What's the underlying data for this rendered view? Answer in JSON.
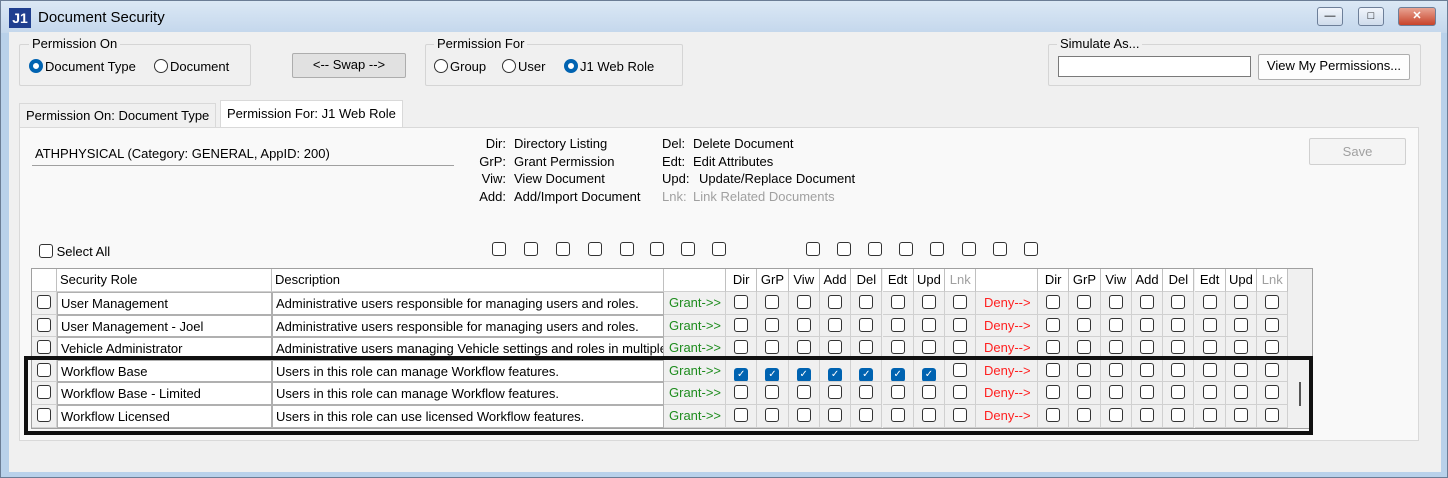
{
  "window": {
    "title": "Document Security",
    "logo": "J1",
    "minimize_icon": "minimize-icon",
    "maximize_icon": "maximize-icon",
    "close_icon": "close-icon"
  },
  "permission_on": {
    "label": "Permission On",
    "options": [
      {
        "label": "Document Type",
        "selected": true
      },
      {
        "label": "Document",
        "selected": false
      }
    ]
  },
  "swap_label": "<-- Swap -->",
  "permission_for": {
    "label": "Permission For",
    "options": [
      {
        "label": "Group",
        "selected": false
      },
      {
        "label": "User",
        "selected": false
      },
      {
        "label": "J1 Web Role",
        "selected": true
      }
    ]
  },
  "simulate": {
    "label": "Simulate As...",
    "value": "",
    "button": "View My Permissions..."
  },
  "tabs": [
    {
      "label": "Permission On: Document Type",
      "active": false
    },
    {
      "label": "Permission For: J1 Web Role",
      "active": true
    }
  ],
  "selected_item": "ATHPHYSICAL (Category: GENERAL, AppID: 200)",
  "legend": [
    {
      "code": "Dir:",
      "text": "Directory Listing"
    },
    {
      "code": "GrP:",
      "text": "Grant Permission"
    },
    {
      "code": "Viw:",
      "text": "View Document"
    },
    {
      "code": "Add:",
      "text": "Add/Import Document"
    },
    {
      "code": "Del:",
      "text": "Delete Document"
    },
    {
      "code": "Edt:",
      "text": "Edit Attributes"
    },
    {
      "code": "Upd:",
      "text": "Update/Replace Document"
    },
    {
      "code": "Lnk:",
      "text": "Link Related Documents",
      "disabled": true
    }
  ],
  "save_label": "Save",
  "select_all_label": "Select All",
  "columns": {
    "role": "Security Role",
    "description": "Description",
    "perms": [
      "Dir",
      "GrP",
      "Viw",
      "Add",
      "Del",
      "Edt",
      "Upd",
      "Lnk"
    ]
  },
  "grant_label": "Grant->>",
  "deny_label": "Deny-->",
  "colors": {
    "grant": "#1e8c1e",
    "deny": "#ff2020",
    "accent": "#0063b1"
  },
  "rows": [
    {
      "role": "User Management",
      "description": "Administrative users responsible for managing users and roles.",
      "grant": [
        0,
        0,
        0,
        0,
        0,
        0,
        0,
        0
      ],
      "deny": [
        0,
        0,
        0,
        0,
        0,
        0,
        0,
        0
      ]
    },
    {
      "role": "User Management - Joel",
      "description": "Administrative users responsible for managing users and roles.",
      "grant": [
        0,
        0,
        0,
        0,
        0,
        0,
        0,
        0
      ],
      "deny": [
        0,
        0,
        0,
        0,
        0,
        0,
        0,
        0
      ]
    },
    {
      "role": "Vehicle Administrator",
      "description": "Administrative users managing Vehicle settings and roles in multiple",
      "grant": [
        0,
        0,
        0,
        0,
        0,
        0,
        0,
        0
      ],
      "deny": [
        0,
        0,
        0,
        0,
        0,
        0,
        0,
        0
      ]
    },
    {
      "role": "Workflow Base",
      "description": "Users in this role can manage Workflow features.",
      "grant": [
        1,
        1,
        1,
        1,
        1,
        1,
        1,
        0
      ],
      "deny": [
        0,
        0,
        0,
        0,
        0,
        0,
        0,
        0
      ]
    },
    {
      "role": "Workflow Base - Limited",
      "description": "Users in this role can manage Workflow features.",
      "grant": [
        0,
        0,
        0,
        0,
        0,
        0,
        0,
        0
      ],
      "deny": [
        0,
        0,
        0,
        0,
        0,
        0,
        0,
        0
      ]
    },
    {
      "role": "Workflow Licensed",
      "description": "Users in this role can use licensed Workflow features.",
      "grant": [
        0,
        0,
        0,
        0,
        0,
        0,
        0,
        0
      ],
      "deny": [
        0,
        0,
        0,
        0,
        0,
        0,
        0,
        0
      ]
    }
  ]
}
